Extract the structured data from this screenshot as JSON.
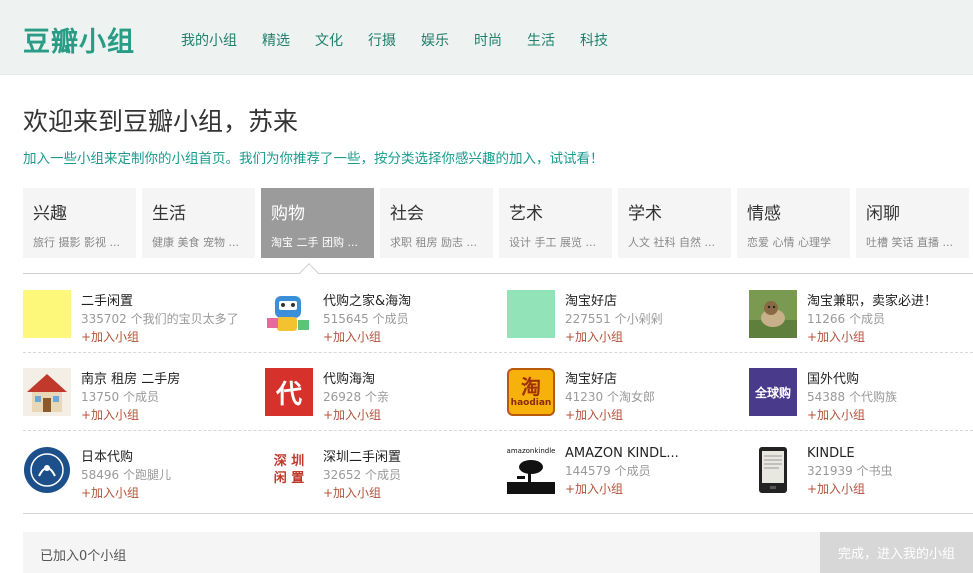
{
  "header": {
    "logo": "豆瓣小组",
    "nav": [
      "我的小组",
      "精选",
      "文化",
      "行摄",
      "娱乐",
      "时尚",
      "生活",
      "科技"
    ]
  },
  "welcome": {
    "title": "欢迎来到豆瓣小组，苏来",
    "intro": "加入一些小组来定制你的小组首页。我们为你推荐了一些，按分类选择你感兴趣的加入，试试看！"
  },
  "categories": [
    {
      "title": "兴趣",
      "sub": "旅行 摄影 影视 ..."
    },
    {
      "title": "生活",
      "sub": "健康 美食 宠物 ..."
    },
    {
      "title": "购物",
      "sub": "淘宝 二手 团购 ..."
    },
    {
      "title": "社会",
      "sub": "求职 租房 励志 ..."
    },
    {
      "title": "艺术",
      "sub": "设计 手工 展览 ..."
    },
    {
      "title": "学术",
      "sub": "人文 社科 自然 ..."
    },
    {
      "title": "情感",
      "sub": "恋爱 心情 心理学"
    },
    {
      "title": "闲聊",
      "sub": "吐槽 笑话 直播 ..."
    }
  ],
  "active_category": "购物",
  "join_label": "+加入小组",
  "groups": [
    {
      "name": "二手闲置",
      "meta": "335702 个我们的宝贝太多了",
      "thumb": "swatch-yellow",
      "color": "#fdf87a"
    },
    {
      "name": "代购之家&海淘",
      "meta": "515645 个成员",
      "thumb": "robot-mascot",
      "color": "#3a8fd8"
    },
    {
      "name": "淘宝好店",
      "meta": "227551 个小剁剁",
      "thumb": "swatch-green",
      "color": "#93e3b8"
    },
    {
      "name": "淘宝兼职，卖家必进！",
      "meta": "11266 个成员",
      "thumb": "dog-photo",
      "color": "#6b8c4a"
    },
    {
      "name": "南京 租房 二手房",
      "meta": "13750 个成员",
      "thumb": "house-icon",
      "color": "#c0392b"
    },
    {
      "name": "代购海淘",
      "meta": "26928 个亲",
      "thumb": "dai-logo",
      "color": "#d6322b",
      "thumb_text": "代"
    },
    {
      "name": "淘宝好店",
      "meta": "41230 个淘女郎",
      "thumb": "taobao-logo",
      "color": "#f6b10a",
      "thumb_text": "淘",
      "thumb_text2": "haodian"
    },
    {
      "name": "国外代购",
      "meta": "54388 个代购族",
      "thumb": "global-buy-logo",
      "color": "#4a3a8c",
      "thumb_text": "全球购"
    },
    {
      "name": "日本代购",
      "meta": "58496 个跑腿儿",
      "thumb": "japan-emblem",
      "color": "#1d4f8a"
    },
    {
      "name": "深圳二手闲置",
      "meta": "32652 个成员",
      "thumb": "shenzhen-text-logo",
      "color": "#c0392b",
      "thumb_text": "深 圳",
      "thumb_text2": "闲 置"
    },
    {
      "name": "AMAZON KINDL...",
      "meta": "144579 个成员",
      "thumb": "amazon-kindle-logo",
      "color": "#111111",
      "thumb_text": "amazonkindle"
    },
    {
      "name": "KINDLE",
      "meta": "321939 个书虫",
      "thumb": "kindle-device",
      "color": "#222222"
    }
  ],
  "footer": {
    "count": "已加入0个小组",
    "done": "完成，进入我的小组"
  }
}
